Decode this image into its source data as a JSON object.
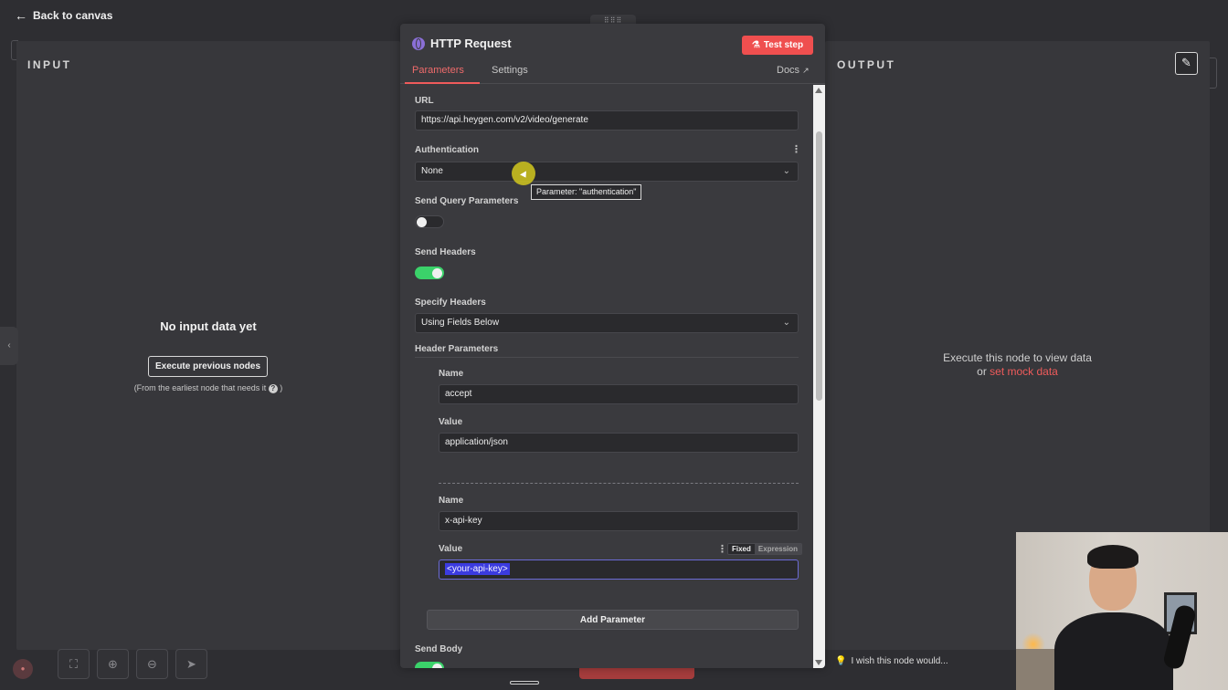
{
  "topbar": {
    "back_label": "Back to canvas"
  },
  "input_panel": {
    "label": "INPUT",
    "empty_title": "No input data yet",
    "execute_button": "Execute previous nodes",
    "hint": "(From the earliest node that needs it",
    "hint_suffix": ")"
  },
  "output_panel": {
    "label": "OUTPUT",
    "hint_line1": "Execute this node to view data",
    "hint_or": "or",
    "mock_link": "set mock data"
  },
  "node": {
    "title": "HTTP Request",
    "test_button": "Test step",
    "tabs": [
      "Parameters",
      "Settings"
    ],
    "active_tab": "Parameters",
    "docs_label": "Docs"
  },
  "params": {
    "url_label": "URL",
    "url_value": "https://api.heygen.com/v2/video/generate",
    "auth_label": "Authentication",
    "auth_value": "None",
    "auth_tooltip": "Parameter: \"authentication\"",
    "send_query_label": "Send Query Parameters",
    "send_query_on": false,
    "send_headers_label": "Send Headers",
    "send_headers_on": true,
    "specify_headers_label": "Specify Headers",
    "specify_headers_value": "Using Fields Below",
    "header_params_label": "Header Parameters",
    "headers": [
      {
        "name_label": "Name",
        "name": "accept",
        "value_label": "Value",
        "value": "application/json"
      },
      {
        "name_label": "Name",
        "name": "x-api-key",
        "value_label": "Value",
        "value": "<your-api-key>"
      }
    ],
    "mode_fixed": "Fixed",
    "mode_expression": "Expression",
    "add_parameter": "Add Parameter",
    "send_body_label": "Send Body",
    "send_body_on": true
  },
  "footer": {
    "wish_label": "I wish this node would..."
  },
  "colors": {
    "accent": "#ef4f4f",
    "toggle_on": "#3bd26a",
    "selection": "#3b3be0"
  }
}
